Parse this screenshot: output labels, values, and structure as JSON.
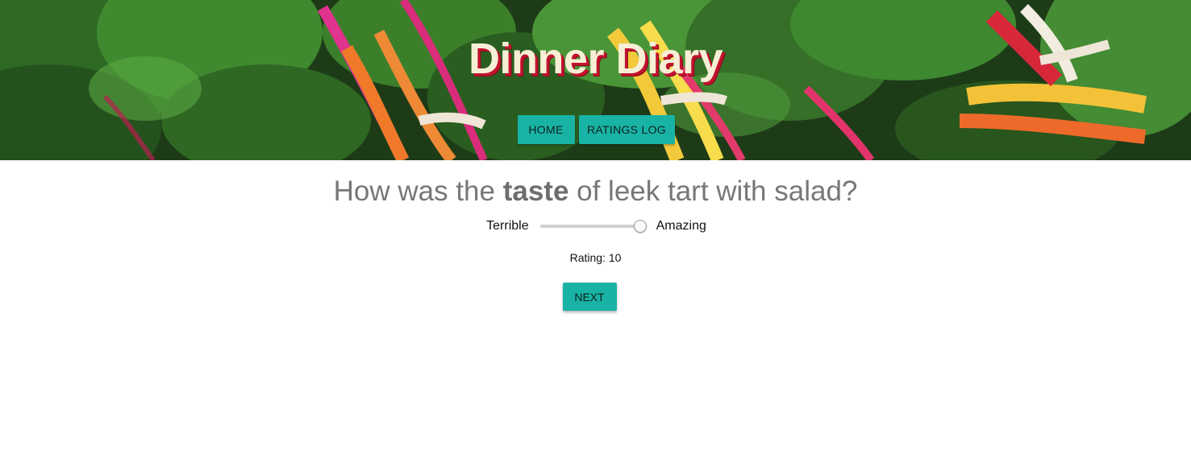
{
  "header": {
    "title": "Dinner Diary",
    "banner_image": "swiss-chard-bunches-photo",
    "nav": [
      {
        "label": "HOME"
      },
      {
        "label": "RATINGS LOG"
      }
    ]
  },
  "main": {
    "question_prefix": "How was the ",
    "question_emphasis": "taste",
    "question_suffix": " of leek tart with salad?",
    "slider": {
      "min_label": "Terrible",
      "max_label": "Amazing",
      "value": 10,
      "min": 0,
      "max": 10
    },
    "rating_text": "Rating: 10",
    "next_label": "NEXT"
  },
  "colors": {
    "button": "#19b3a5",
    "title_text": "#f6efd6",
    "title_shadow": "#c4122e",
    "question_text": "#777777"
  }
}
